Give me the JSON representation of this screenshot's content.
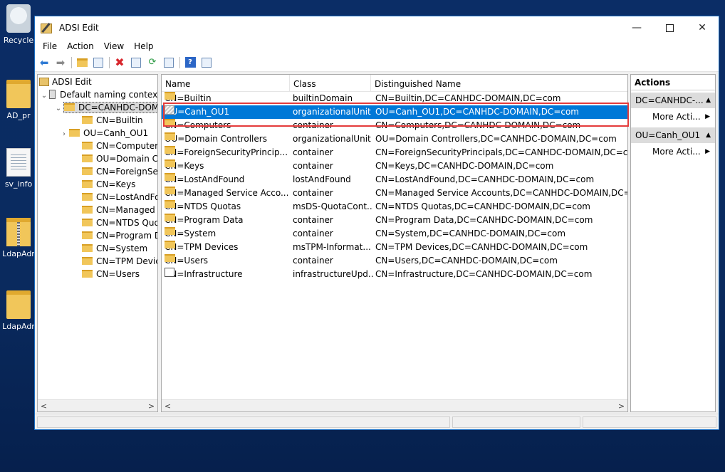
{
  "desktop": {
    "icons": [
      {
        "label": "Recycle",
        "kind": "bin"
      },
      {
        "label": "AD_pr",
        "kind": "folder"
      },
      {
        "label": "sv_info",
        "kind": "doc"
      },
      {
        "label": "LdapAdr",
        "kind": "zip"
      },
      {
        "label": "LdapAdr",
        "kind": "folder"
      }
    ]
  },
  "window": {
    "title": "ADSI Edit",
    "controls": {
      "minimize": "—",
      "close": "✕"
    }
  },
  "menu": [
    "File",
    "Action",
    "View",
    "Help"
  ],
  "tree": {
    "root": "ADSI Edit",
    "naming_context": "Default naming context",
    "domain": "DC=CANHDC-DOM",
    "children": [
      "CN=Builtin",
      "OU=Canh_OU1",
      "CN=Computers",
      "OU=Domain Co",
      "CN=ForeignSecu",
      "CN=Keys",
      "CN=LostAndFou",
      "CN=Managed S",
      "CN=NTDS Quot",
      "CN=Program Da",
      "CN=System",
      "CN=TPM Device",
      "CN=Users"
    ]
  },
  "list": {
    "columns": [
      "Name",
      "Class",
      "Distinguished Name"
    ],
    "rows": [
      {
        "name": "CN=Builtin",
        "class": "builtinDomain",
        "dn": "CN=Builtin,DC=CANHDC-DOMAIN,DC=com",
        "icon": "folder"
      },
      {
        "name": "OU=Canh_OU1",
        "class": "organizationalUnit",
        "dn": "OU=Canh_OU1,DC=CANHDC-DOMAIN,DC=com",
        "icon": "ou"
      },
      {
        "name": "CN=Computers",
        "class": "container",
        "dn": "CN=Computers,DC=CANHDC-DOMAIN,DC=com",
        "icon": "folder"
      },
      {
        "name": "OU=Domain Controllers",
        "class": "organizationalUnit",
        "dn": "OU=Domain Controllers,DC=CANHDC-DOMAIN,DC=com",
        "icon": "folder"
      },
      {
        "name": "CN=ForeignSecurityPrincip...",
        "class": "container",
        "dn": "CN=ForeignSecurityPrincipals,DC=CANHDC-DOMAIN,DC=com",
        "icon": "folder"
      },
      {
        "name": "CN=Keys",
        "class": "container",
        "dn": "CN=Keys,DC=CANHDC-DOMAIN,DC=com",
        "icon": "folder"
      },
      {
        "name": "CN=LostAndFound",
        "class": "lostAndFound",
        "dn": "CN=LostAndFound,DC=CANHDC-DOMAIN,DC=com",
        "icon": "folder"
      },
      {
        "name": "CN=Managed Service Acco...",
        "class": "container",
        "dn": "CN=Managed Service Accounts,DC=CANHDC-DOMAIN,DC=com",
        "icon": "folder"
      },
      {
        "name": "CN=NTDS Quotas",
        "class": "msDS-QuotaCont...",
        "dn": "CN=NTDS Quotas,DC=CANHDC-DOMAIN,DC=com",
        "icon": "folder"
      },
      {
        "name": "CN=Program Data",
        "class": "container",
        "dn": "CN=Program Data,DC=CANHDC-DOMAIN,DC=com",
        "icon": "folder"
      },
      {
        "name": "CN=System",
        "class": "container",
        "dn": "CN=System,DC=CANHDC-DOMAIN,DC=com",
        "icon": "folder"
      },
      {
        "name": "CN=TPM Devices",
        "class": "msTPM-Informat...",
        "dn": "CN=TPM Devices,DC=CANHDC-DOMAIN,DC=com",
        "icon": "folder"
      },
      {
        "name": "CN=Users",
        "class": "container",
        "dn": "CN=Users,DC=CANHDC-DOMAIN,DC=com",
        "icon": "folder"
      },
      {
        "name": "CN=Infrastructure",
        "class": "infrastructureUpd...",
        "dn": "CN=Infrastructure,DC=CANHDC-DOMAIN,DC=com",
        "icon": "infra"
      }
    ],
    "selected_index": 1
  },
  "actions": {
    "title": "Actions",
    "groups": [
      {
        "label": "DC=CANHDC-...",
        "item": "More Acti..."
      },
      {
        "label": "OU=Canh_OU1",
        "item": "More Acti..."
      }
    ]
  },
  "colors": {
    "selection": "#0078d7",
    "highlight_box": "#e43b3b"
  }
}
